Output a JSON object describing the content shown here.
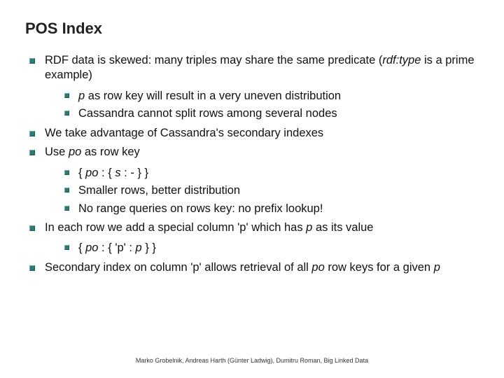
{
  "title": "POS Index",
  "bullets": {
    "b1": {
      "pre": "RDF data is skewed: many triples may share the same predicate (",
      "it": "rdf:type",
      "post": " is a prime example)"
    },
    "b1s": {
      "a_pre": "",
      "a_it": "p",
      "a_post": " as row key will result in a very uneven distribution",
      "b": "Cassandra cannot split rows among several nodes"
    },
    "b2": "We take advantage of Cassandra's secondary indexes",
    "b3": {
      "pre": "Use ",
      "it": "po",
      "post": " as row key"
    },
    "b3s": {
      "a_pre": "{ ",
      "a_it1": "po",
      "a_mid": " : { ",
      "a_it2": "s",
      "a_post": " : - } }",
      "b": "Smaller rows, better distribution",
      "c": "No range queries on rows key: no prefix lookup!"
    },
    "b4": {
      "pre": "In each row we add a special column 'p' which has ",
      "it": "p",
      "post": " as its value"
    },
    "b4s": {
      "a_pre": "{ ",
      "a_it1": "po",
      "a_mid": " : { 'p' : ",
      "a_it2": "p",
      "a_post": " } }"
    },
    "b5": {
      "pre": "Secondary index on column 'p' allows retrieval of all ",
      "it": "po",
      "mid": " row keys for a given ",
      "it2": "p"
    }
  },
  "footer": "Marko Grobelnik, Andreas Harth (Günter Ladwig), Dumitru Roman, Big Linked Data"
}
